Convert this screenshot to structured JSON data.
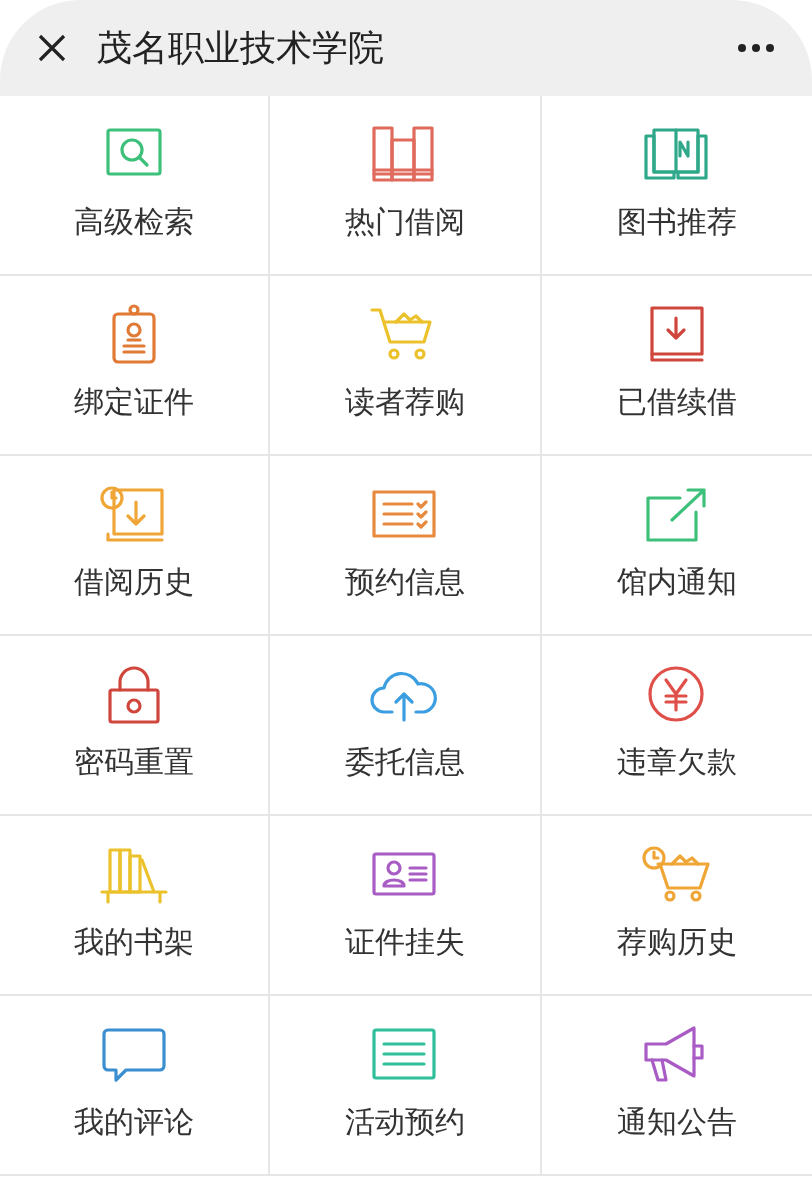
{
  "header": {
    "title": "茂名职业技术学院"
  },
  "menu": [
    {
      "label": "高级检索",
      "kind": "search"
    },
    {
      "label": "热门借阅",
      "kind": "books"
    },
    {
      "label": "图书推荐",
      "kind": "open-book"
    },
    {
      "label": "绑定证件",
      "kind": "badge"
    },
    {
      "label": "读者荐购",
      "kind": "cart"
    },
    {
      "label": "已借续借",
      "kind": "download-book"
    },
    {
      "label": "借阅历史",
      "kind": "history-book"
    },
    {
      "label": "预约信息",
      "kind": "checklist"
    },
    {
      "label": "馆内通知",
      "kind": "share"
    },
    {
      "label": "密码重置",
      "kind": "lock"
    },
    {
      "label": "委托信息",
      "kind": "cloud"
    },
    {
      "label": "违章欠款",
      "kind": "yen"
    },
    {
      "label": "我的书架",
      "kind": "shelf"
    },
    {
      "label": "证件挂失",
      "kind": "id-card"
    },
    {
      "label": "荐购历史",
      "kind": "cart-history"
    },
    {
      "label": "我的评论",
      "kind": "comment"
    },
    {
      "label": "活动预约",
      "kind": "list"
    },
    {
      "label": "通知公告",
      "kind": "megaphone"
    }
  ]
}
